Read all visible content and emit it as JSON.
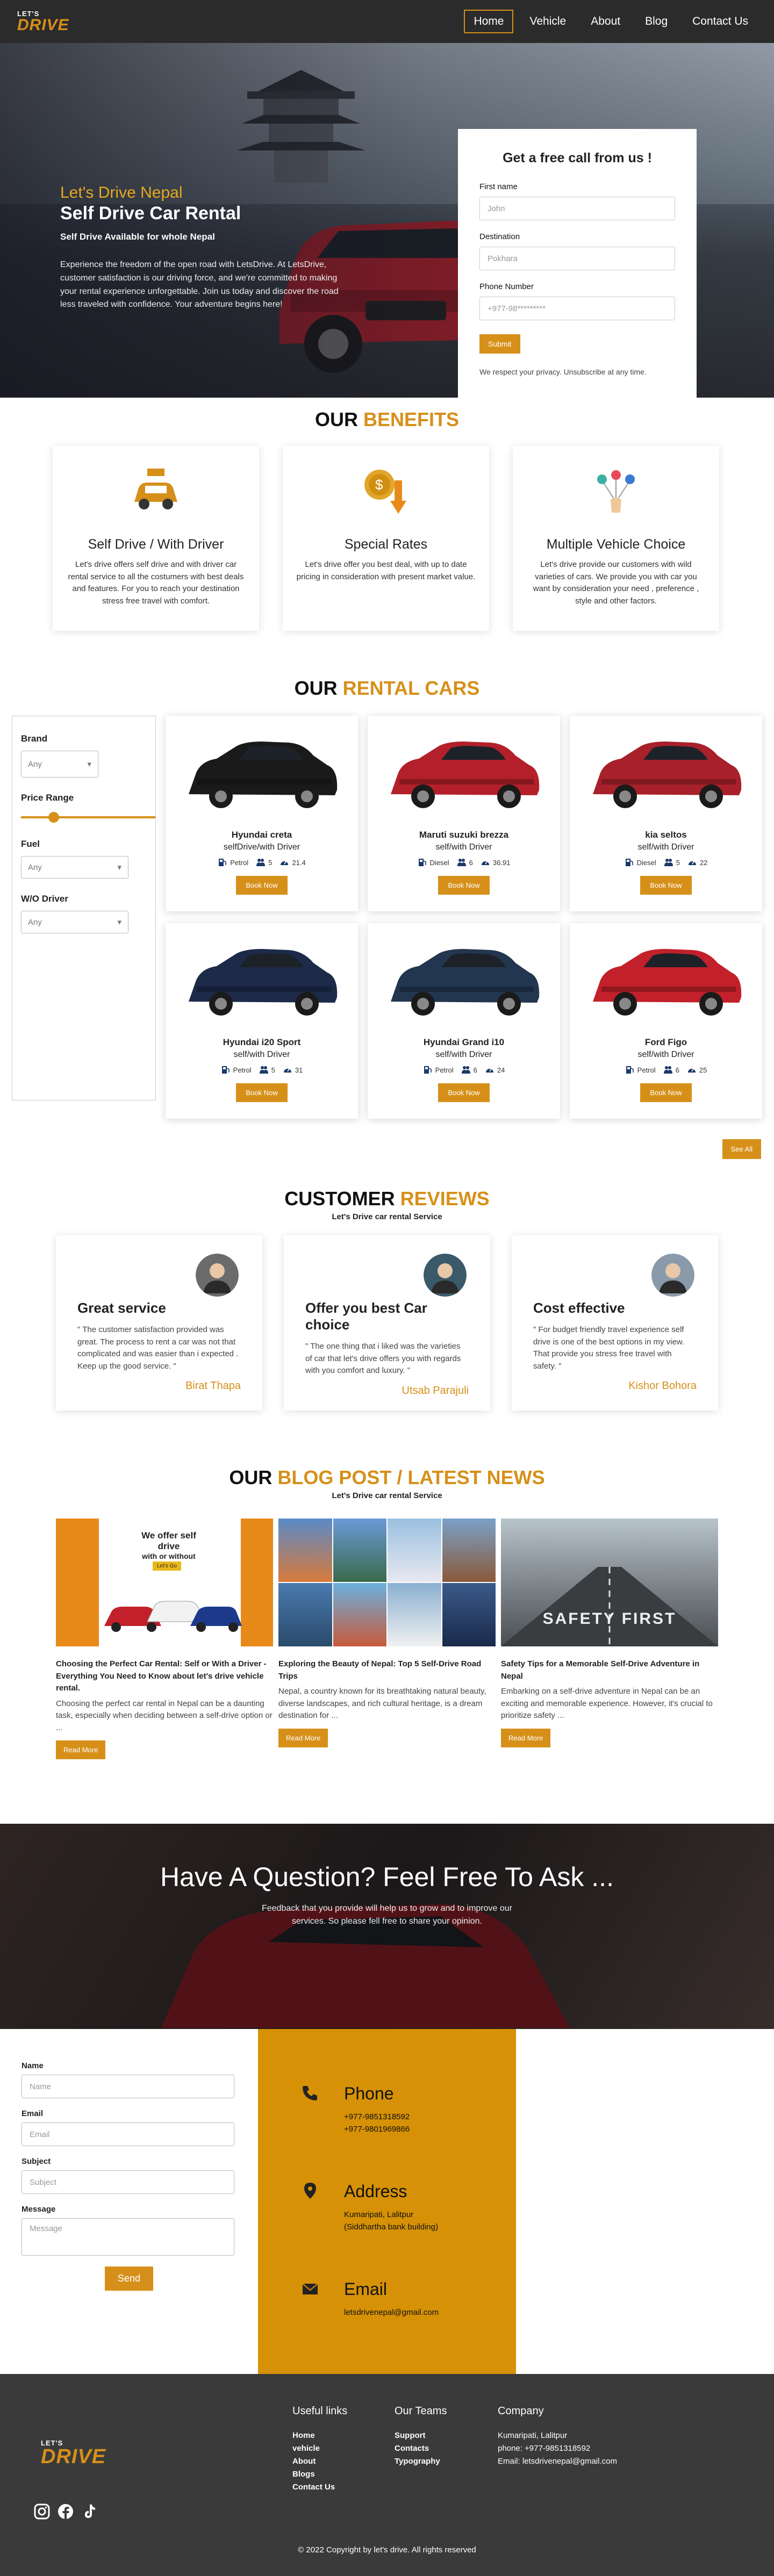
{
  "nav": {
    "logo_top": "LET'S",
    "logo_bottom": "DRIVE",
    "items": [
      {
        "label": "Home",
        "active": true
      },
      {
        "label": "Vehicle"
      },
      {
        "label": "About"
      },
      {
        "label": "Blog"
      },
      {
        "label": "Contact Us"
      }
    ]
  },
  "hero": {
    "title": "Let's Drive Nepal",
    "subtitle": "Self Drive Car Rental",
    "tagline": "Self Drive Available for whole Nepal",
    "description": "Experience the freedom of the open road with LetsDrive. At LetsDrive, customer satisfaction is our driving force, and we're committed to making your rental experience unforgettable. Join us today and discover the road less traveled with confidence. Your adventure begins here!",
    "form": {
      "heading": "Get a free call from us !",
      "first_name_label": "First name",
      "first_name_placeholder": "John",
      "destination_label": "Destination",
      "destination_placeholder": "Pokhara",
      "phone_label": "Phone Number",
      "phone_placeholder": "+977-98*********",
      "submit_label": "Submit",
      "privacy_note": "We respect your privacy. Unsubscribe at any time."
    }
  },
  "benefits": {
    "title_plain": "OUR",
    "title_accent": "BENEFITS",
    "cards": [
      {
        "icon": "rent-car-icon",
        "title": "Self Drive / With Driver",
        "text": "Let's drive offers self drive and with driver car rental service to all the costumers with best deals and features. For you to reach your destination stress free travel with comfort."
      },
      {
        "icon": "price-drop-icon",
        "title": "Special Rates",
        "text": "Let's drive offer you best deal, with up to date pricing in consideration with present market value."
      },
      {
        "icon": "choice-icon",
        "title": "Multiple Vehicle Choice",
        "text": "Let's drive provide our customers with wild varieties of cars. We provide you with car you want by consideration your need , preference , style and other factors."
      }
    ]
  },
  "rental": {
    "title_plain": "OUR",
    "title_accent": "RENTAL CARS",
    "filters": {
      "brand_label": "Brand",
      "brand_value": "Any",
      "price_label": "Price Range",
      "price_level": 0.22,
      "fuel_label": "Fuel",
      "fuel_value": "Any",
      "driver_label": "W/O Driver",
      "driver_value": "Any"
    },
    "cars": [
      {
        "name": "Hyundai creta",
        "type": "selfDrive/with Driver",
        "fuel": "Petrol",
        "seats": "5",
        "mileage": "21.4",
        "color": "#1a1a1a"
      },
      {
        "name": "Maruti suzuki brezza",
        "type": "self/with Driver",
        "fuel": "Diesel",
        "seats": "6",
        "mileage": "36.91",
        "color": "#b3202a"
      },
      {
        "name": "kia seltos",
        "type": "self/with Driver",
        "fuel": "Diesel",
        "seats": "5",
        "mileage": "22",
        "color": "#a8202a"
      },
      {
        "name": "Hyundai i20 Sport",
        "type": "self/with Driver",
        "fuel": "Petrol",
        "seats": "5",
        "mileage": "31",
        "color": "#1d2a4a"
      },
      {
        "name": "Hyundai Grand i10",
        "type": "self/with Driver",
        "fuel": "Petrol",
        "seats": "6",
        "mileage": "24",
        "color": "#233650"
      },
      {
        "name": "Ford Figo",
        "type": "self/with Driver",
        "fuel": "Petrol",
        "seats": "6",
        "mileage": "25",
        "color": "#c2202a"
      }
    ],
    "book_label": "Book Now",
    "see_all_label": "See All"
  },
  "reviews": {
    "title_plain": "CUSTOMER",
    "title_accent": "REVIEWS",
    "subtitle": "Let's Drive car rental Service",
    "cards": [
      {
        "title": "Great service",
        "text": "\" The customer satisfaction provided was great. The process to rent a car was not that complicated and was easier than i expected . Keep up the good service. \"",
        "author": "Birat Thapa",
        "avatar_color": "#6b6b6b"
      },
      {
        "title": "Offer you best Car choice",
        "text": "\" The one thing that i liked was the varieties of car that let's drive offers you with regards with you comfort and luxury. \"",
        "author": "Utsab Parajuli",
        "avatar_color": "#3a5a6a"
      },
      {
        "title": "Cost effective",
        "text": "\" For budget friendly travel experience self drive is one of the best options in my view. That provide you stress free travel with safety. \"",
        "author": "Kishor Bohora",
        "avatar_color": "#8a9aaa"
      }
    ]
  },
  "blog": {
    "title_plain": "OUR",
    "title_accent": "BLOG POST / LATEST NEWS",
    "subtitle": "Let's Drive car rental Service",
    "posts": [
      {
        "title": "Choosing the Perfect Car Rental: Self or With a Driver - Everything You Need to Know about let's drive vehicle rental.",
        "excerpt": "Choosing the perfect car rental in Nepal can be a daunting task, especially when deciding between a self-drive option or ...",
        "img_text1": "We offer self drive",
        "img_text2": "with or without driver",
        "img_badge": "Let's Go"
      },
      {
        "title": "Exploring the Beauty of Nepal: Top 5 Self-Drive Road Trips",
        "excerpt": "Nepal, a country known for its breathtaking natural beauty, diverse landscapes, and rich cultural heritage, is a dream destination for ..."
      },
      {
        "title": "Safety Tips for a Memorable Self-Drive Adventure in Nepal",
        "excerpt": "Embarking on a self-drive adventure in Nepal can be an exciting and memorable experience. However, it's crucial to prioritize safety ...",
        "img_text": "SAFETY FIRST"
      }
    ],
    "read_more_label": "Read More"
  },
  "question": {
    "title": "Have A Question? Feel Free To Ask ...",
    "text": "Feedback that you provide will help us to grow and to improve our services. So please fell free to share your opinion."
  },
  "contact_form": {
    "name_label": "Name",
    "name_placeholder": "Name",
    "email_label": "Email",
    "email_placeholder": "Email",
    "subject_label": "Subject",
    "subject_placeholder": "Subject",
    "message_label": "Message",
    "message_placeholder": "Message",
    "send_label": "Send"
  },
  "contact_info": {
    "phone_title": "Phone",
    "phone_1": "+977-9851318592",
    "phone_2": "+977-9801969866",
    "address_title": "Address",
    "address_1": "Kumaripati, Lalitpur",
    "address_2": "(Siddhartha bank building)",
    "email_title": "Email",
    "email_1": "letsdrivenepal@gmail.com"
  },
  "footer": {
    "logo_top": "LET'S",
    "logo_bottom": "DRIVE",
    "useful_title": "Useful links",
    "useful_links": [
      "Home",
      "vehicle",
      "About",
      "Blogs",
      "Contact Us"
    ],
    "teams_title": "Our Teams",
    "teams_links": [
      "Support",
      "Contacts",
      "Typography"
    ],
    "company_title": "Company",
    "company_lines": [
      "Kumaripati, Lalitpur",
      "phone: +977-9851318592",
      "Email: letsdrivenepal@gmail.com"
    ],
    "copyright": "© 2022 Copyright by let's drive. All rights reserved"
  },
  "colors": {
    "accent": "#d6901a",
    "nav_bg": "#2b2b2b",
    "contact_bg": "#d69106",
    "footer_bg": "#3a3a3a"
  }
}
